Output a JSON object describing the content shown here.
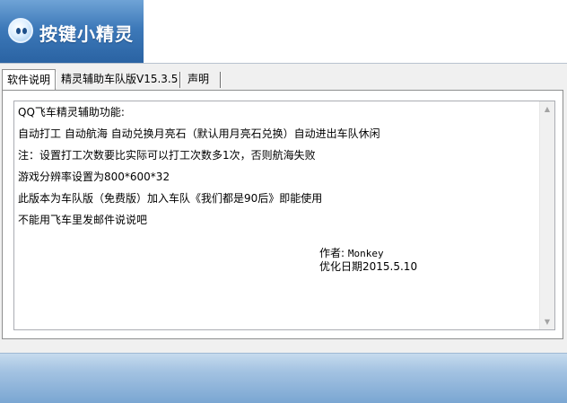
{
  "header": {
    "app_name": "按键小精灵"
  },
  "tabs": [
    {
      "label": "软件说明",
      "active": true
    },
    {
      "label": "精灵辅助车队版V15.3.5",
      "active": false
    },
    {
      "label": "声明",
      "active": false
    }
  ],
  "content": {
    "lines": [
      "QQ飞车精灵辅助功能:",
      "自动打工 自动航海 自动兑换月亮石（默认用月亮石兑换）自动进出车队休闲",
      "注：设置打工次数要比实际可以打工次数多1次，否则航海失败",
      "游戏分辨率设置为800*600*32",
      "此版本为车队版（免费版）加入车队《我们都是90后》即能使用",
      "不能用飞车里发邮件说说吧"
    ],
    "author_label": "作者:",
    "author_name": "Monkey",
    "date_line": "优化日期2015.5.10"
  },
  "scrollbar": {
    "up_icon": "scroll-up-arrow-icon",
    "down_icon": "scroll-down-arrow-icon"
  },
  "colors": {
    "banner_blue": "#3d79b9",
    "footer_blue": "#a4c3e2"
  }
}
